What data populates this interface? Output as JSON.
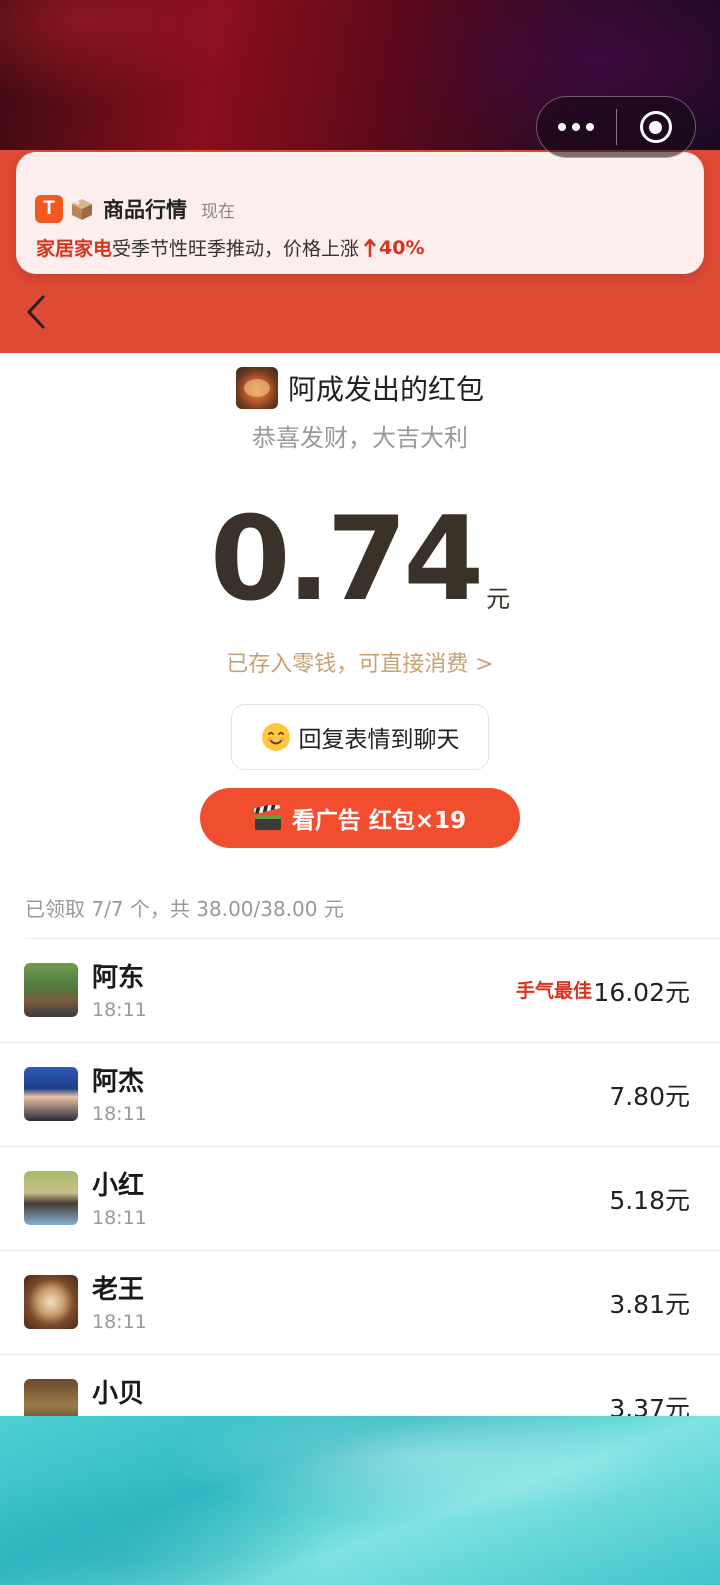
{
  "notification": {
    "app_badge": "T",
    "title": "商品行情",
    "time": "现在",
    "highlight": "家居家电",
    "body": "受季节性旺季推动，价格上涨",
    "change": "40%"
  },
  "envelope": {
    "sender": "阿成发出的红包",
    "greeting": "恭喜发财，大吉大利",
    "amount": "0.74",
    "unit": "元",
    "wallet_link": "已存入零钱，可直接消费 >",
    "reply_button": "回复表情到聊天",
    "ad_button": "看广告 红包×19"
  },
  "summary": "已领取 7/7 个，共 38.00/38.00 元",
  "best_label": "手气最佳",
  "recipients": [
    {
      "name": "阿东",
      "time": "18:11",
      "amount": "16.02元",
      "best": true
    },
    {
      "name": "阿杰",
      "time": "18:11",
      "amount": "7.80元",
      "best": false
    },
    {
      "name": "小红",
      "time": "18:11",
      "amount": "5.18元",
      "best": false
    },
    {
      "name": "老王",
      "time": "18:11",
      "amount": "3.81元",
      "best": false
    },
    {
      "name": "小贝",
      "time": "",
      "amount": "3.37元",
      "best": false
    }
  ],
  "colors": {
    "header_red": "#de4a35",
    "ad_button": "#f14e30",
    "highlight_red": "#d8331f",
    "gold_text": "#c9a173"
  },
  "icons": [
    "more-icon",
    "close-circle-icon",
    "back-arrow-icon",
    "app-badge-icon",
    "package-box-icon",
    "arrow-up-icon",
    "smile-emoji-icon",
    "clapperboard-icon"
  ]
}
